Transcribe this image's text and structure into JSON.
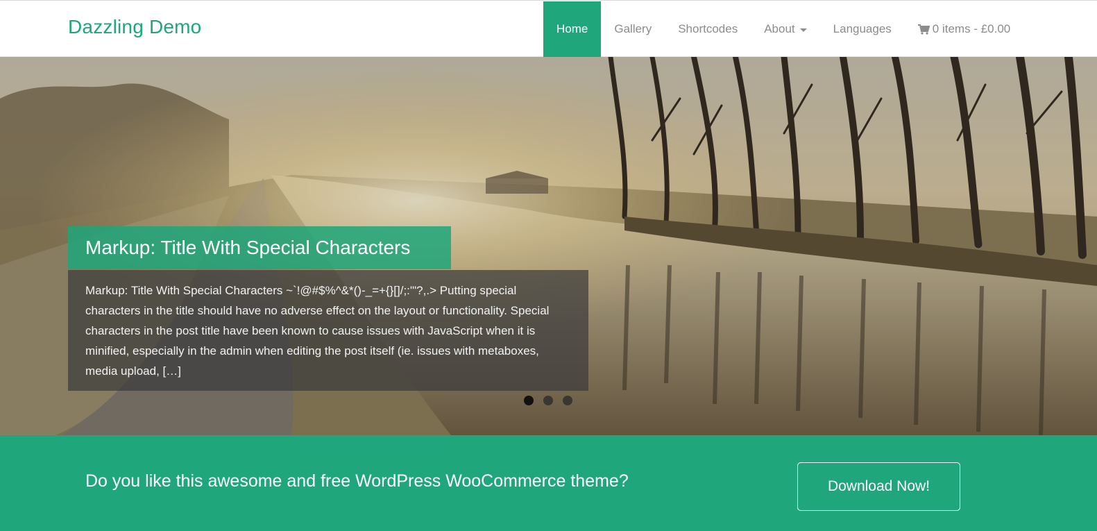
{
  "site": {
    "brand": "Dazzling Demo"
  },
  "nav": {
    "home": "Home",
    "gallery": "Gallery",
    "shortcodes": "Shortcodes",
    "about": "About",
    "languages": "Languages",
    "cart": "0 items - £0.00"
  },
  "slider": {
    "title": "Markup: Title With Special Characters",
    "excerpt": "Markup: Title With Special Characters ~`!@#$%^&*()-_=+{}[]/;:'\"?,.> Putting special characters in the title should have no adverse effect on the layout or functionality. Special characters in the post title have been known to cause issues with JavaScript when it is minified, especially in the admin when editing the post itself (ie. issues with metaboxes, media upload, […]",
    "slide_count": 3,
    "active_slide": 1
  },
  "cta": {
    "text": "Do you like this awesome and free WordPress WooCommerce theme?",
    "button": "Download Now!"
  },
  "colors": {
    "accent": "#1fa67a"
  }
}
